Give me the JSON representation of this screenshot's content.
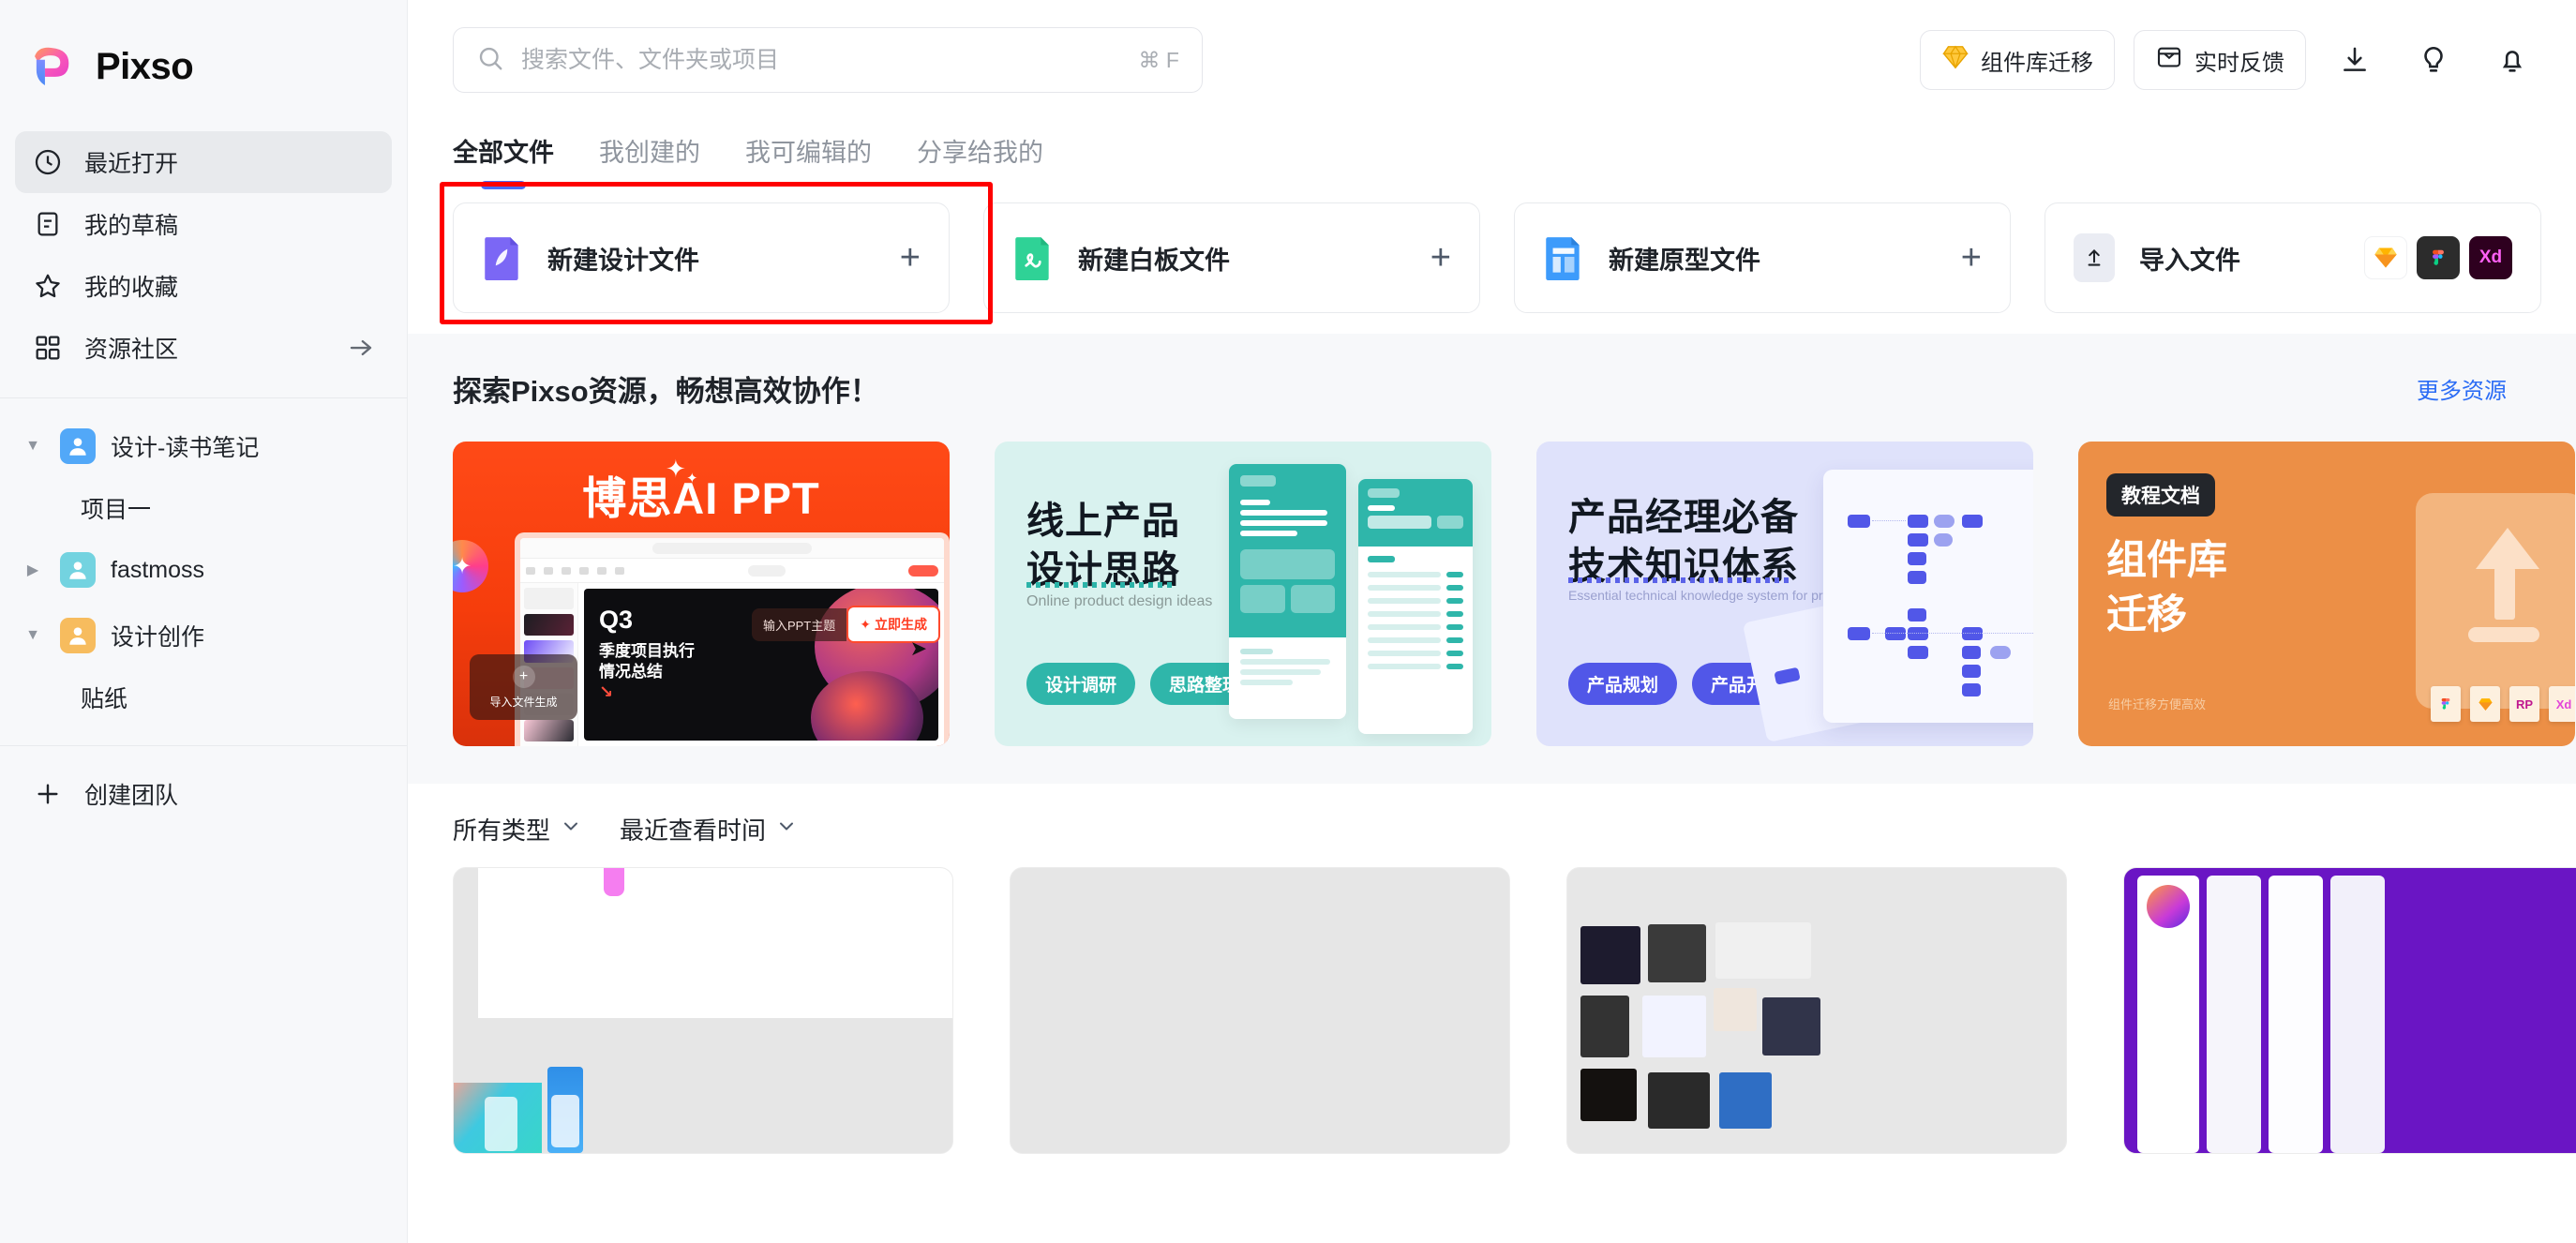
{
  "brand": {
    "name": "Pixso"
  },
  "sidebar": {
    "nav": [
      {
        "label": "最近打开",
        "icon": "clock-icon",
        "active": true
      },
      {
        "label": "我的草稿",
        "icon": "document-icon",
        "active": false
      },
      {
        "label": "我的收藏",
        "icon": "star-icon",
        "active": false
      },
      {
        "label": "资源社区",
        "icon": "grid-icon",
        "active": false,
        "arrow": "→"
      }
    ],
    "teams": [
      {
        "label": "设计-读书笔记",
        "avatar_color": "#52a8f8",
        "expanded": true,
        "projects": [
          {
            "label": "项目一"
          }
        ]
      },
      {
        "label": "fastmoss",
        "avatar_color": "#73d3e0",
        "expanded": false,
        "projects": []
      },
      {
        "label": "设计创作",
        "avatar_color": "#f7bc5e",
        "expanded": true,
        "projects": [
          {
            "label": "贴纸"
          }
        ]
      }
    ],
    "create_team": {
      "label": "创建团队",
      "icon": "plus-icon"
    }
  },
  "topbar": {
    "search": {
      "placeholder": "搜索文件、文件夹或项目",
      "value": "",
      "shortcut": "⌘ F",
      "icon": "search-icon"
    },
    "buttons": [
      {
        "label": "组件库迁移",
        "icon": "diamond-icon"
      },
      {
        "label": "实时反馈",
        "icon": "inbox-icon"
      }
    ],
    "icons": [
      {
        "name": "download-icon"
      },
      {
        "name": "lightbulb-icon"
      },
      {
        "name": "bell-icon"
      }
    ]
  },
  "tabs": [
    {
      "label": "全部文件",
      "active": true
    },
    {
      "label": "我创建的",
      "active": false
    },
    {
      "label": "我可编辑的",
      "active": false
    },
    {
      "label": "分享给我的",
      "active": false
    }
  ],
  "create_cards": [
    {
      "label": "新建设计文件",
      "icon": "design-file-icon",
      "action": "+",
      "highlighted": true
    },
    {
      "label": "新建白板文件",
      "icon": "whiteboard-file-icon",
      "action": "+",
      "highlighted": false
    },
    {
      "label": "新建原型文件",
      "icon": "prototype-file-icon",
      "action": "+",
      "highlighted": false
    },
    {
      "label": "导入文件",
      "icon": "upload-icon",
      "logos": [
        "sketch-logo",
        "figma-logo",
        "xd-logo"
      ],
      "highlighted": false
    }
  ],
  "resources": {
    "title": "探索Pixso资源，畅想高效协作！",
    "more_label": "更多资源",
    "cards": [
      {
        "id": "ai-ppt",
        "title": "博思AI PPT",
        "slide_title": "Q3",
        "slide_line1": "季度项目执行",
        "slide_line2": "情况总结",
        "import_label": "导入文件生成",
        "prompt_placeholder": "输入PPT主题",
        "generate_label": "立即生成",
        "bg": "#f63d0c"
      },
      {
        "id": "online-product",
        "title_line1": "线上产品",
        "title_line2": "设计思路",
        "subtitle": "Online product design ideas",
        "tags": [
          "设计调研",
          "思路整理"
        ],
        "bg": "#d9f2ef",
        "accent": "#2fb6aa"
      },
      {
        "id": "pm-tech",
        "title_line1": "产品经理必备",
        "title_line2": "技术知识体系",
        "subtitle": "Essential technical knowledge system for product managers",
        "tags": [
          "产品规划",
          "产品开发"
        ],
        "bg": "#dfe2fb",
        "accent": "#5157e8"
      },
      {
        "id": "component-migration",
        "badge": "教程文档",
        "title_line1": "组件库",
        "title_line2": "迁移",
        "subtitle": "组件迁移方便高效",
        "bg": "#ec8f46",
        "file_chips": [
          "Fi",
          "Sk",
          "RP",
          "Xd"
        ]
      }
    ]
  },
  "filters": [
    {
      "label": "所有类型",
      "icon": "chevron-down-icon"
    },
    {
      "label": "最近查看时间",
      "icon": "chevron-down-icon"
    }
  ],
  "files": [
    {
      "id": "file-1",
      "thumb": "mobile-app-mockups"
    },
    {
      "id": "file-2",
      "thumb": "blank"
    },
    {
      "id": "file-3",
      "thumb": "screenshot-collage"
    },
    {
      "id": "file-4",
      "thumb": "podcast-app-ui"
    }
  ],
  "colors": {
    "accent": "#4b6cfa",
    "link": "#2b6cf5",
    "highlight_box": "#ff0000",
    "sidebar_bg": "#f7f8fa",
    "section_bg": "#f7f8fa"
  }
}
